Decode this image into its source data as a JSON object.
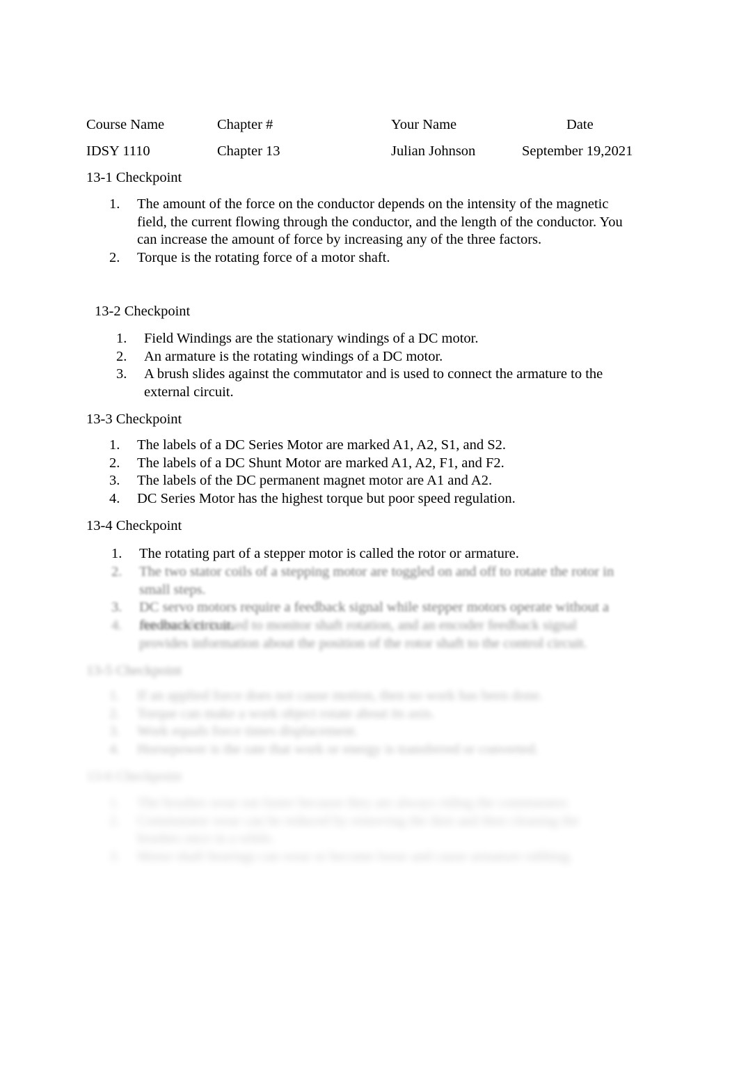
{
  "document": {
    "header": {
      "labels": {
        "course": "Course Name",
        "chapter": "Chapter #",
        "name": "Your Name",
        "date": "Date"
      },
      "values": {
        "course": "IDSY 1110",
        "chapter": "Chapter 13",
        "name": "Julian Johnson",
        "date": "September 19,2021"
      }
    },
    "sections": [
      {
        "heading": "13-1 Checkpoint",
        "items": [
          {
            "num": "1.",
            "text": "The amount of the force on the conductor depends on the intensity of the magnetic field, the current flowing through the conductor, and the length of the conductor. You can increase the amount of force by increasing any of the three factors."
          },
          {
            "num": "2.",
            "text": "Torque is the rotating force of a motor shaft."
          }
        ]
      },
      {
        "heading": "13-2 Checkpoint",
        "items": [
          {
            "num": "1.",
            "text": "Field Windings are the stationary windings of a DC motor."
          },
          {
            "num": "2.",
            "text": "An armature is the rotating windings of a DC motor."
          },
          {
            "num": "3.",
            "text": "A brush slides against the commutator and is used to connect the armature to the external circuit."
          }
        ]
      },
      {
        "heading": "13-3 Checkpoint",
        "items": [
          {
            "num": "1.",
            "text": "The labels of a DC Series Motor are marked A1, A2, S1, and S2."
          },
          {
            "num": "2.",
            "text": "The labels of a DC Shunt Motor are marked A1, A2, F1, and F2."
          },
          {
            "num": "3.",
            "text": "The labels of the DC permanent magnet motor are A1 and A2."
          },
          {
            "num": "4.",
            "text": "DC Series Motor has the highest torque but poor speed regulation."
          }
        ]
      },
      {
        "heading": "13-4 Checkpoint",
        "items": [
          {
            "num": "1.",
            "text": "The rotating part of a stepper motor is called the rotor or armature."
          },
          {
            "num": "2.",
            "text": "The two stator coils of a stepping motor are toggled on and off to rotate the rotor in small steps."
          },
          {
            "num": "3.",
            "text": "DC servo motors require a feedback signal while stepper motors operate without a feedback circuit."
          },
          {
            "num": "4.",
            "text": "An encoder is used to monitor shaft rotation, and an encoder feedback signal provides information about the position of the rotor shaft to the control circuit."
          }
        ]
      },
      {
        "heading": "13-5 Checkpoint",
        "items": [
          {
            "num": "1.",
            "text": "If an applied force does not cause motion, then no work has been done."
          },
          {
            "num": "2.",
            "text": "Torque can make a work object rotate about its axis."
          },
          {
            "num": "3.",
            "text": "Work equals force times displacement."
          },
          {
            "num": "4.",
            "text": "Horsepower is the rate that work or energy is transferred or converted."
          }
        ]
      },
      {
        "heading": "13-6 Checkpoint",
        "items": [
          {
            "num": "1.",
            "text": "The brushes wear out faster because they are always riding the commutator."
          },
          {
            "num": "2.",
            "text": "Commutator wear can be reduced by removing the dust and then cleaning the brushes once in a while."
          },
          {
            "num": "3.",
            "text": "Motor shaft bearings can wear or become loose and cause armature rubbing."
          }
        ]
      }
    ]
  }
}
